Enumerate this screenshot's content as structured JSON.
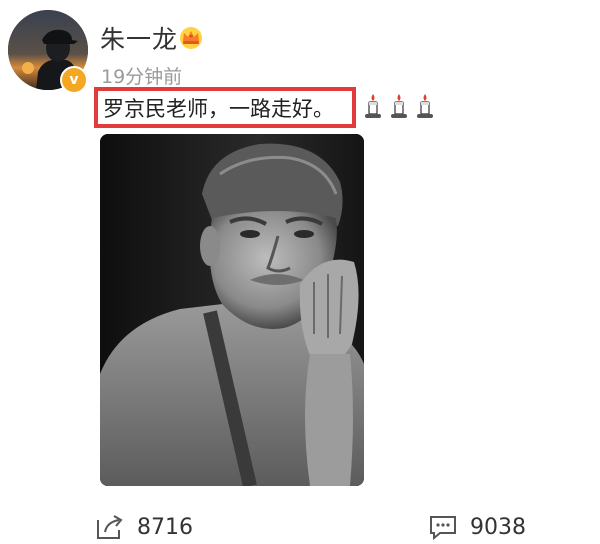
{
  "post": {
    "author": "朱一龙",
    "verified_badge": "v",
    "crown_icon": "crown-icon",
    "timestamp": "19分钟前",
    "text": "罗京民老师，一路走好。",
    "emoji_icons": [
      "candle-icon",
      "candle-icon",
      "candle-icon"
    ],
    "highlight_color": "#e23b3b"
  },
  "actions": {
    "share_count": "8716",
    "comment_count": "9038"
  }
}
